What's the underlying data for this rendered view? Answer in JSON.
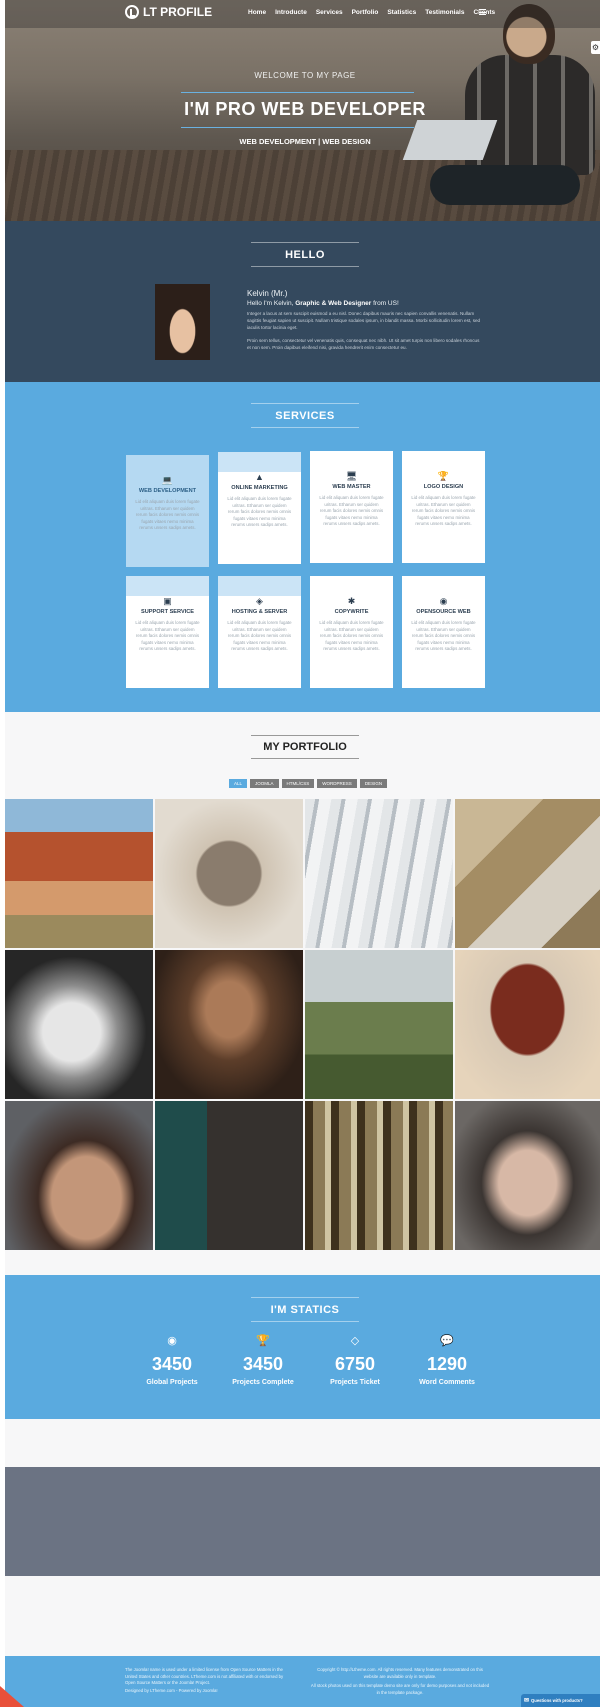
{
  "header": {
    "logo_text": "LT PROFILE",
    "nav": [
      "Home",
      "Introducte",
      "Services",
      "Portfolio",
      "Statistics",
      "Testimonials",
      "Clients"
    ],
    "menu_icon": "hamburger-icon",
    "settings_icon": "gear-icon"
  },
  "hero": {
    "welcome": "WELCOME TO MY PAGE",
    "title": "I'M PRO WEB DEVELOPER",
    "subtitle": "WEB DEVELOPMENT | WEB DESIGN"
  },
  "hello": {
    "title": "HELLO",
    "name": "Kelvin (Mr.)",
    "intro_prefix": "Hello I'm Kelvin,",
    "intro_bold": "Graphic & Web Designer",
    "intro_suffix": "from US!",
    "paragraph1": "Integer a lacus at sem suscipit euismod a eu nisl. Donec dapibus mauris nec sapien convallis venenatis. Nullam sagittis feugiat sapien ut suscipit. Nullam tristique sodales ipsum, in blandit massa. Morbi sollicitudin lorem est, sed iaculis tortor lacinia eget.",
    "paragraph2": "Proin sem tellus, consectetur vel venenatis quis, consequat nec nibh. Ut sit amet turpis non libero sodales rhoncus et non sem. Proin dapibus eleifend nisi, gravida hendrerit enim consectetur eu."
  },
  "services": {
    "title": "SERVICES",
    "items": [
      {
        "title": "WEB DEVELOPMENT",
        "icon": "laptop-icon",
        "desc": "Lid elit aliquam duis lorem fugate uritras. Etharum ser quidem rerum facis dolores nemis omnis fugats vitaes nemo minima rerums unsers sadips amets."
      },
      {
        "title": "ONLINE MARKETING",
        "icon": "road-icon",
        "desc": "Lid elit aliquam duis lorem fugate uritras. Etharum ser quidem rerum facis dolores nemis omnis fugats vitaes nemo minima rerums unsers sadips amets."
      },
      {
        "title": "WEB MASTER",
        "icon": "desktop-icon",
        "desc": "Lid elit aliquam duis lorem fugate uritras. Etharum ser quidem rerum facis dolores nemis omnis fugats vitaes nemo minima rerums unsers sadips amets."
      },
      {
        "title": "LOGO DESIGN",
        "icon": "trophy-icon",
        "desc": "Lid elit aliquam duis lorem fugate uritras. Etharum ser quidem rerum facis dolores nemis omnis fugats vitaes nemo minima rerums unsers sadips amets."
      },
      {
        "title": "SUPPORT SERVICE",
        "icon": "file-icon",
        "desc": "Lid elit aliquam duis lorem fugate uritras. Etharum ser quidem rerum facis dolores nemis omnis fugats vitaes nemo minima rerums unsers sadips amets."
      },
      {
        "title": "HOSTING & SERVER",
        "icon": "dropbox-icon",
        "desc": "Lid elit aliquam duis lorem fugate uritras. Etharum ser quidem rerum facis dolores nemis omnis fugats vitaes nemo minima rerums unsers sadips amets."
      },
      {
        "title": "COPYWRITE",
        "icon": "asterisk-icon",
        "desc": "Lid elit aliquam duis lorem fugate uritras. Etharum ser quidem rerum facis dolores nemis omnis fugats vitaes nemo minima rerums unsers sadips amets."
      },
      {
        "title": "OPENSOURCE WEB",
        "icon": "globe-icon",
        "desc": "Lid elit aliquam duis lorem fugate uritras. Etharum ser quidem rerum facis dolores nemis omnis fugats vitaes nemo minima rerums unsers sadips amets."
      }
    ]
  },
  "portfolio": {
    "title": "MY PORTFOLIO",
    "filters": [
      "ALL",
      "JOOMLA",
      "HTML/CSS",
      "WORDPRESS",
      "DESIGN"
    ],
    "selected_filter": "ALL",
    "images": [
      "canyon",
      "skull-sketch",
      "hand-window",
      "crane-port",
      "statue",
      "woman-hat",
      "wedding-couple",
      "heart-tree",
      "man-portrait",
      "woman-dark",
      "forest",
      "two-women"
    ]
  },
  "statics": {
    "title": "I'M STATICS",
    "items": [
      {
        "icon": "globe-icon",
        "value": "3450",
        "label": "Global Projects"
      },
      {
        "icon": "trophy-icon",
        "value": "3450",
        "label": "Projects Complete"
      },
      {
        "icon": "diamond-icon",
        "value": "6750",
        "label": "Projects Ticket"
      },
      {
        "icon": "comments-icon",
        "value": "1290",
        "label": "Word Comments"
      }
    ]
  },
  "footer": {
    "left": "The Joomla! name is used under a limited license from Open Source Matters in the United States and other countries. LTheme.com is not affiliated with or endorsed by Open Source Matters or the Joomla! Project.",
    "left_credit": "Designed by LTheme.com - Powered by Joomla!",
    "right": "Copyright © http://Ltheme.com. All rights reserved. Many features demonstrated on this website are available only in template.",
    "right2": "All stock photos used on this template demo site are only for demo purposes and not included in the template package.",
    "chat_label": "Questions with products?"
  },
  "colors": {
    "accent": "#5aaadf",
    "dark": "#34495e",
    "gray_band": "#6b7383"
  }
}
